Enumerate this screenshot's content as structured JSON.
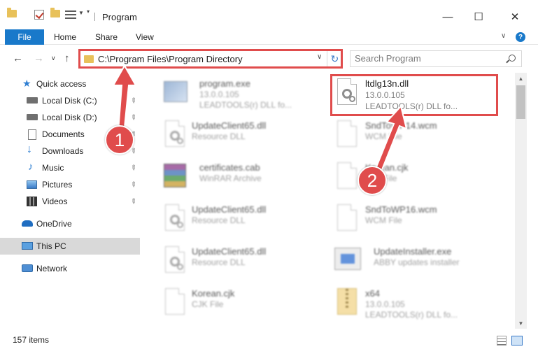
{
  "window": {
    "title": "Program",
    "minimize": "—",
    "maximize": "☐",
    "close": "✕"
  },
  "ribbon": {
    "tabs": [
      "File",
      "Home",
      "Share",
      "View"
    ],
    "collapse_glyph": "∨",
    "help_glyph": "?"
  },
  "nav": {
    "back": "←",
    "forward": "→",
    "recent": "∨",
    "up": "↑",
    "address": "C:\\Program Files\\Program Directory",
    "address_dropdown": "∨",
    "refresh": "↻",
    "search_placeholder": "Search Program"
  },
  "sidebar": {
    "items": [
      {
        "label": "Quick access",
        "icon": "star-icon",
        "pinned": false
      },
      {
        "label": "Local Disk (C:)",
        "icon": "drive-icon",
        "pinned": true
      },
      {
        "label": "Local Disk (D:)",
        "icon": "drive-icon",
        "pinned": true
      },
      {
        "label": "Documents",
        "icon": "documents-icon",
        "pinned": true
      },
      {
        "label": "Downloads",
        "icon": "download-icon",
        "pinned": true
      },
      {
        "label": "Music",
        "icon": "music-icon",
        "pinned": true
      },
      {
        "label": "Pictures",
        "icon": "pictures-icon",
        "pinned": true
      },
      {
        "label": "Videos",
        "icon": "videos-icon",
        "pinned": true
      },
      {
        "label": "OneDrive",
        "icon": "cloud-icon",
        "pinned": false
      },
      {
        "label": "This PC",
        "icon": "computer-icon",
        "pinned": false,
        "selected": true
      },
      {
        "label": "Network",
        "icon": "network-icon",
        "pinned": false
      }
    ],
    "pin_glyph": "📌"
  },
  "files": [
    {
      "name": "program.exe",
      "line2": "13.0.0.105",
      "line3": "LEADTOOLS(r) DLL fo...",
      "icon": "exe-icon"
    },
    {
      "name": "ltdlg13n.dll",
      "line2": "13.0.0.105",
      "line3": "LEADTOOLS(r) DLL fo...",
      "icon": "dll-icon"
    },
    {
      "name": "UpdateClient65.dll",
      "line2": "Resource DLL",
      "line3": "",
      "icon": "dll-icon"
    },
    {
      "name": "SndToWP14.wcm",
      "line2": "WCM File",
      "line3": "",
      "icon": "file-icon"
    },
    {
      "name": "certificates.cab",
      "line2": "WinRAR Archive",
      "line3": "",
      "icon": "winrar-icon"
    },
    {
      "name": "Korean.cjk",
      "line2": "CJK File",
      "line3": "",
      "icon": "file-icon"
    },
    {
      "name": "UpdateClient65.dll",
      "line2": "Resource DLL",
      "line3": "",
      "icon": "dll-icon"
    },
    {
      "name": "SndToWP16.wcm",
      "line2": "WCM File",
      "line3": "",
      "icon": "file-icon"
    },
    {
      "name": "UpdateClient65.dll",
      "line2": "Resource DLL",
      "line3": "",
      "icon": "dll-icon"
    },
    {
      "name": "UpdateInstaller.exe",
      "line2": "ABBY updates installer",
      "line3": "",
      "icon": "installer-icon"
    },
    {
      "name": "Korean.cjk",
      "line2": "CJK File",
      "line3": "",
      "icon": "file-icon"
    },
    {
      "name": "x64",
      "line2": "13.0.0.105",
      "line3": "LEADTOOLS(r) DLL fo...",
      "icon": "zip-folder-icon"
    }
  ],
  "status": {
    "item_count": "157 items"
  },
  "annotations": {
    "step1": "1",
    "step2": "2"
  },
  "colors": {
    "accent": "#1979ca",
    "highlight": "#e04c4c",
    "selection": "#d9d9d9"
  }
}
